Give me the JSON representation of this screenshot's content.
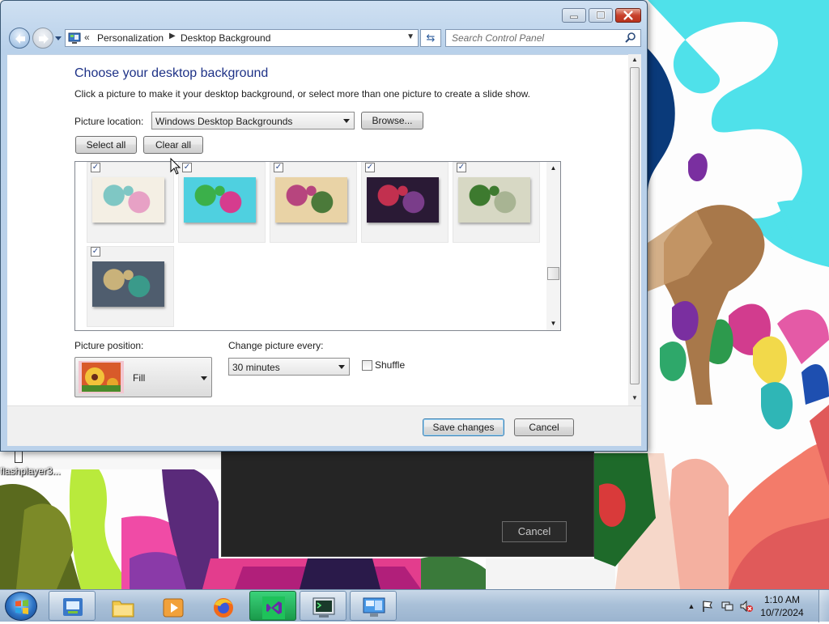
{
  "window": {
    "breadcrumb": [
      "Personalization",
      "Desktop Background"
    ],
    "overflow_chevron": "«",
    "search_placeholder": "Search Control Panel"
  },
  "page": {
    "heading": "Choose your desktop background",
    "instructions": "Click a picture to make it your desktop background, or select more than one picture to create a slide show."
  },
  "picture_location": {
    "label": "Picture location:",
    "value": "Windows Desktop Backgrounds",
    "browse_label": "Browse..."
  },
  "selection_buttons": {
    "select_all": "Select all",
    "clear_all": "Clear all"
  },
  "gallery": {
    "items": [
      {
        "name": "wallpaper-1",
        "checked": true,
        "colors": [
          "#f4efe4",
          "#7fc7c4",
          "#e7a1c5"
        ]
      },
      {
        "name": "wallpaper-2",
        "checked": true,
        "colors": [
          "#4fd0e0",
          "#3bb04a",
          "#d63c8e"
        ]
      },
      {
        "name": "wallpaper-3",
        "checked": true,
        "colors": [
          "#e9d3a6",
          "#b7457e",
          "#4b7a3a"
        ]
      },
      {
        "name": "wallpaper-4",
        "checked": true,
        "colors": [
          "#2a1a35",
          "#c2304f",
          "#7a3d8a"
        ]
      },
      {
        "name": "wallpaper-5",
        "checked": true,
        "colors": [
          "#d7d8c4",
          "#3d7a2f",
          "#a8b493"
        ]
      },
      {
        "name": "wallpaper-6",
        "checked": true,
        "colors": [
          "#4f5d6e",
          "#c9b27a",
          "#3a9a8a"
        ]
      }
    ],
    "check_glyph": "✓"
  },
  "picture_position": {
    "label": "Picture position:",
    "value": "Fill"
  },
  "interval": {
    "label": "Change picture every:",
    "value": "30 minutes"
  },
  "shuffle": {
    "label": "Shuffle",
    "checked": false
  },
  "footer": {
    "save_label": "Save changes",
    "cancel_label": "Cancel"
  },
  "background_dialog": {
    "cancel_label": "Cancel"
  },
  "desktop": {
    "icon_label": "flashplayer3..."
  },
  "taskbar": {
    "apps": [
      {
        "name": "control-panel-window",
        "icon": "control-panel-icon",
        "state": "open"
      },
      {
        "name": "windows-explorer",
        "icon": "folder-icon",
        "state": "pinned"
      },
      {
        "name": "media-player",
        "icon": "media-player-icon",
        "state": "pinned"
      },
      {
        "name": "firefox",
        "icon": "firefox-icon",
        "state": "pinned"
      },
      {
        "name": "visual-studio",
        "icon": "visual-studio-icon",
        "state": "open"
      },
      {
        "name": "terminal-app",
        "icon": "terminal-icon",
        "state": "open"
      },
      {
        "name": "remote-desktop",
        "icon": "remote-desktop-icon",
        "state": "open"
      }
    ],
    "clock_time": "1:10 AM",
    "clock_date": "10/7/2024"
  },
  "colors": {
    "heading_blue": "#1e3287",
    "window_frame": "#b9d1ea",
    "close_red": "#c8412c",
    "taskbar": "#a9c0d8"
  }
}
